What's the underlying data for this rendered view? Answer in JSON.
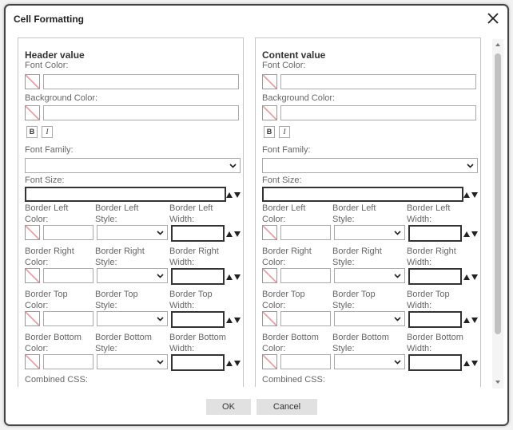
{
  "dialog": {
    "title": "Cell Formatting",
    "ok_label": "OK",
    "cancel_label": "Cancel"
  },
  "labels": {
    "font_color": "Font Color:",
    "background_color": "Background Color:",
    "bold": "B",
    "italic": "I",
    "font_family": "Font Family:",
    "font_size": "Font Size:",
    "combined_css": "Combined CSS:"
  },
  "panels": [
    {
      "title": "Header value"
    },
    {
      "title": "Content value"
    }
  ],
  "borders": [
    {
      "color_label": [
        "Border Left",
        "Color:"
      ],
      "style_label": [
        "Border Left",
        "Style:"
      ],
      "width_label": [
        "Border Left",
        "Width:"
      ]
    },
    {
      "color_label": [
        "Border Right",
        "Color:"
      ],
      "style_label": [
        "Border Right",
        "Style:"
      ],
      "width_label": [
        "Border Right",
        "Width:"
      ]
    },
    {
      "color_label": [
        "Border Top",
        "Color:"
      ],
      "style_label": [
        "Border Top",
        "Style:"
      ],
      "width_label": [
        "Border Top",
        "Width:"
      ]
    },
    {
      "color_label": [
        "Border Bottom",
        "Color:"
      ],
      "style_label": [
        "Border Bottom",
        "Style:"
      ],
      "width_label": [
        "Border Bottom",
        "Width:"
      ]
    }
  ],
  "colors": {
    "swatch_stripe": "#e8a2a6",
    "dialog_border": "#444444",
    "button_bg": "#e1e1e1"
  },
  "icons": {
    "close": "close-icon",
    "dropdown": "chevron-down-icon",
    "spinner": "spinner-arrows-icon"
  }
}
